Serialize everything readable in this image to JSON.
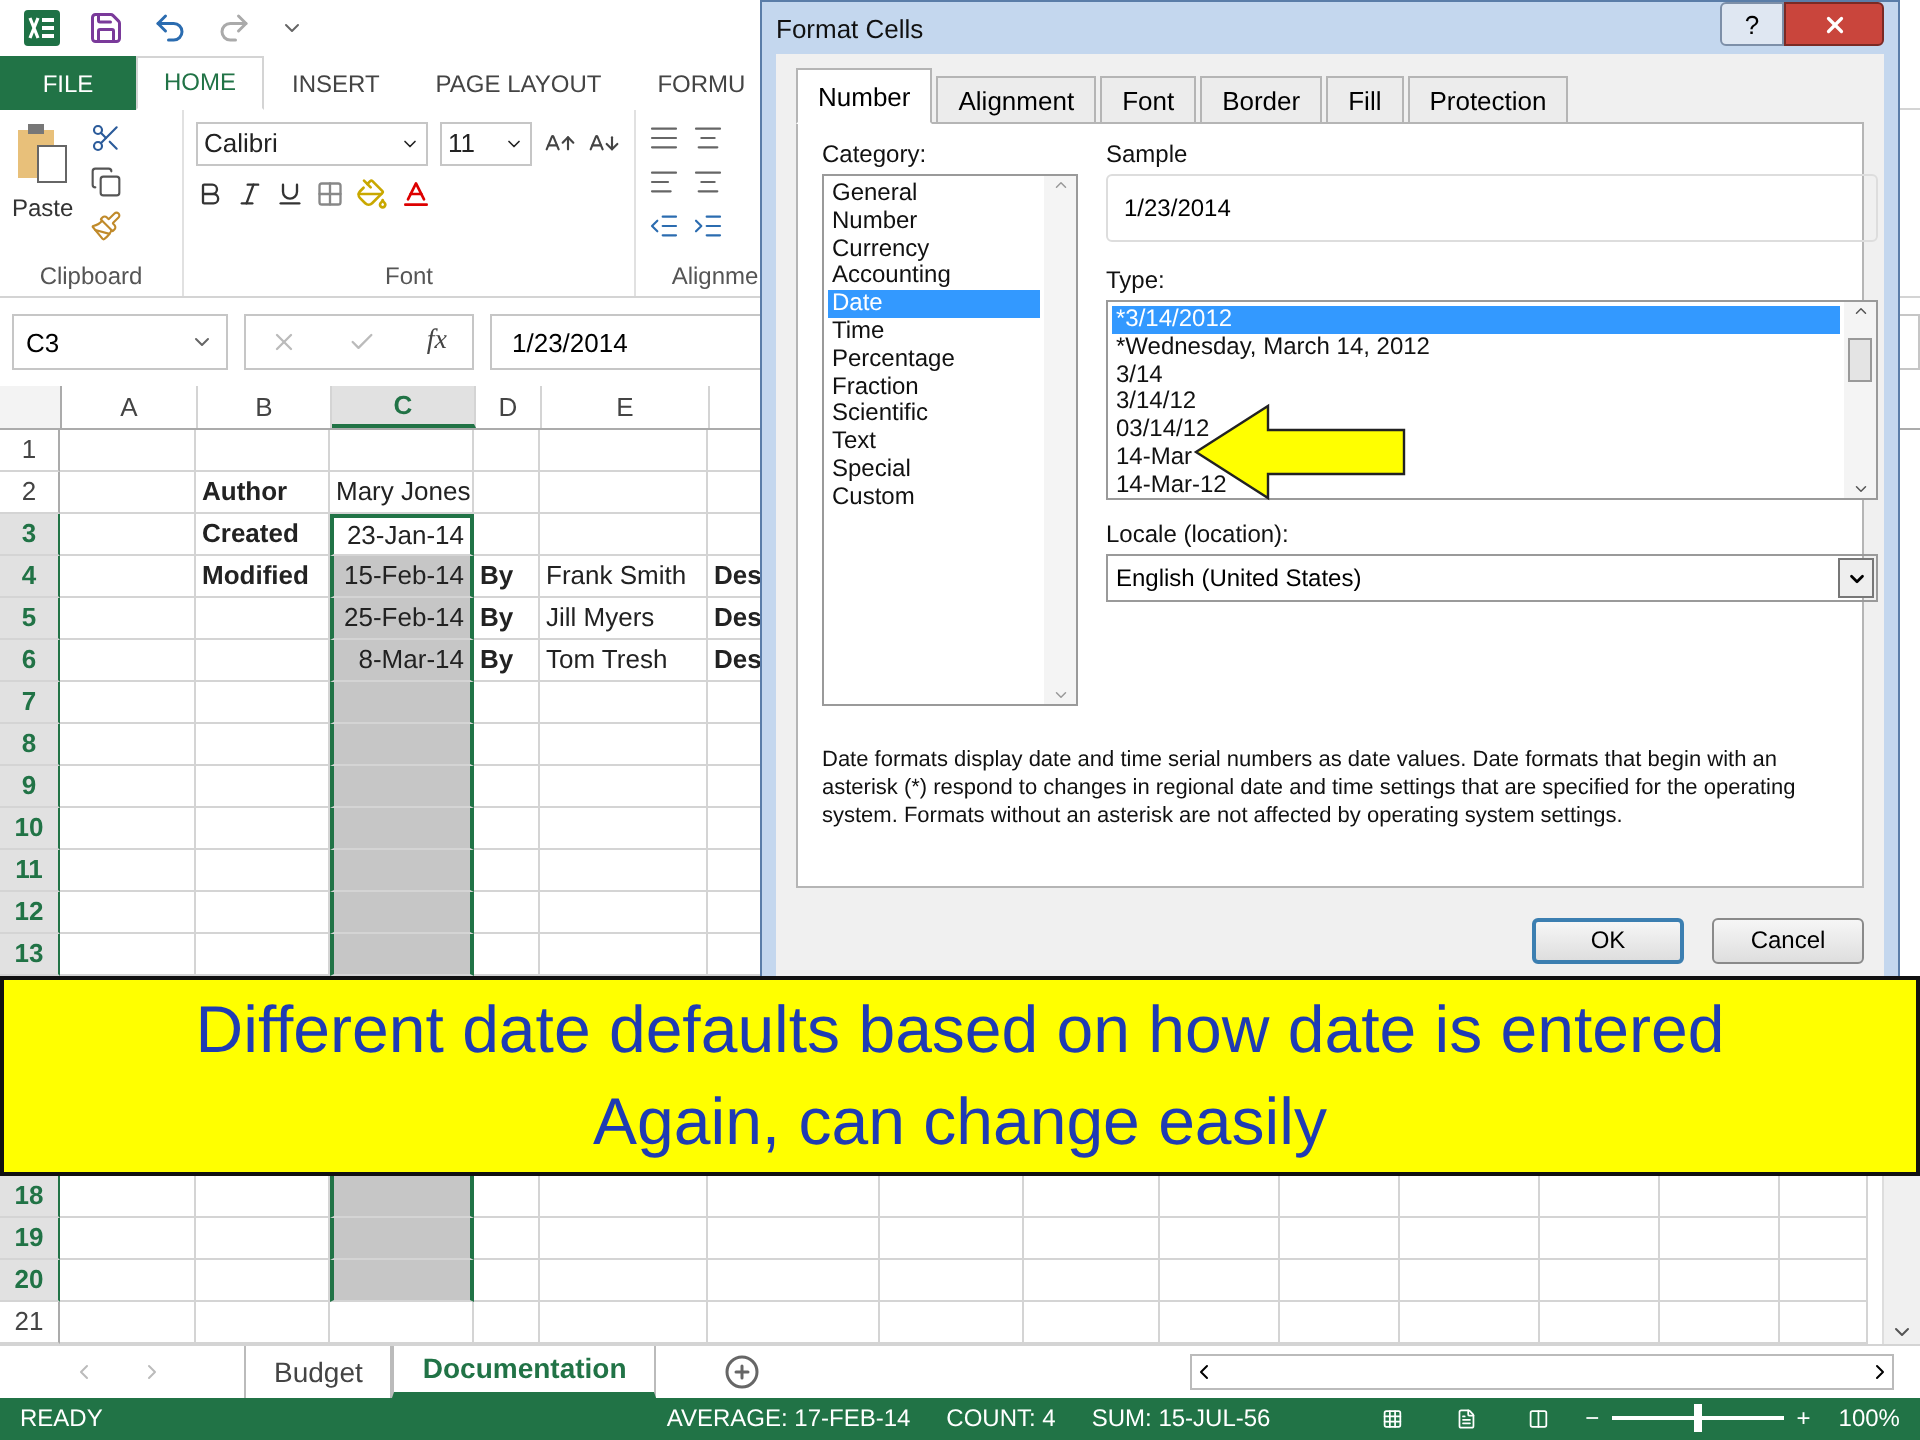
{
  "ribbon_tabs": [
    {
      "label": "FILE",
      "kind": "file",
      "selected": false
    },
    {
      "label": "HOME",
      "kind": "tab",
      "selected": true
    },
    {
      "label": "INSERT",
      "kind": "tab",
      "selected": false
    },
    {
      "label": "PAGE LAYOUT",
      "kind": "tab",
      "selected": false
    },
    {
      "label": "FORMU",
      "kind": "tab",
      "selected": false
    }
  ],
  "ribbon": {
    "paste_label": "Paste",
    "font_name": "Calibri",
    "font_size": "11",
    "groups": [
      "Clipboard",
      "Font",
      "Alignme"
    ]
  },
  "formula_bar": {
    "name_box": "C3",
    "fx": "fx",
    "value": "1/23/2014"
  },
  "sheet": {
    "columns": [
      {
        "label": "A",
        "selected": false
      },
      {
        "label": "B",
        "selected": false
      },
      {
        "label": "C",
        "selected": true
      },
      {
        "label": "D",
        "selected": false
      },
      {
        "label": "E",
        "selected": false
      }
    ],
    "rows_top": [
      {
        "number": "1",
        "selected": false,
        "active": false
      },
      {
        "number": "2",
        "selected": false,
        "active": false,
        "cells": {
          "B": {
            "text": "Author",
            "kind": "label"
          },
          "C": {
            "text": "Mary Jones",
            "kind": "text"
          }
        }
      },
      {
        "number": "3",
        "selected": true,
        "active": true,
        "cells": {
          "B": {
            "text": "Created",
            "kind": "label"
          },
          "C": {
            "text": "23-Jan-14",
            "kind": "date"
          }
        }
      },
      {
        "number": "4",
        "selected": true,
        "active": false,
        "cells": {
          "B": {
            "text": "Modified",
            "kind": "label"
          },
          "C": {
            "text": "15-Feb-14",
            "kind": "date"
          },
          "D": {
            "text": "By",
            "kind": "label"
          },
          "E": {
            "text": "Frank Smith",
            "kind": "text"
          },
          "F": {
            "text": "Des",
            "kind": "label"
          }
        }
      },
      {
        "number": "5",
        "selected": true,
        "active": false,
        "cells": {
          "C": {
            "text": "25-Feb-14",
            "kind": "date"
          },
          "D": {
            "text": "By",
            "kind": "label"
          },
          "E": {
            "text": "Jill Myers",
            "kind": "text"
          },
          "F": {
            "text": "Des",
            "kind": "label"
          }
        }
      },
      {
        "number": "6",
        "selected": true,
        "active": false,
        "cells": {
          "C": {
            "text": "8-Mar-14",
            "kind": "date"
          },
          "D": {
            "text": "By",
            "kind": "label"
          },
          "E": {
            "text": "Tom Tresh",
            "kind": "text"
          },
          "F": {
            "text": "Des",
            "kind": "label"
          }
        }
      },
      {
        "number": "7",
        "selected": true,
        "active": false
      },
      {
        "number": "8",
        "selected": true,
        "active": false
      },
      {
        "number": "9",
        "selected": true,
        "active": false
      },
      {
        "number": "10",
        "selected": true,
        "active": false
      },
      {
        "number": "11",
        "selected": true,
        "active": false
      },
      {
        "number": "12",
        "selected": true,
        "active": false
      },
      {
        "number": "13",
        "selected": true,
        "active": false
      }
    ],
    "rows_bottom": [
      {
        "number": "18",
        "selected": true,
        "active": false
      },
      {
        "number": "19",
        "selected": true,
        "active": false
      },
      {
        "number": "20",
        "selected": true,
        "active": false
      },
      {
        "number": "21",
        "selected": false,
        "active": false
      }
    ],
    "sheet_tabs": [
      {
        "label": "Budget",
        "selected": false
      },
      {
        "label": "Documentation",
        "selected": true
      }
    ]
  },
  "banner": {
    "lines": [
      "Different date defaults based on how date is entered",
      "Again, can change easily"
    ]
  },
  "dialog": {
    "title": "Format Cells",
    "help": "?",
    "tabs": [
      {
        "label": "Number",
        "selected": true
      },
      {
        "label": "Alignment",
        "selected": false
      },
      {
        "label": "Font",
        "selected": false
      },
      {
        "label": "Border",
        "selected": false
      },
      {
        "label": "Fill",
        "selected": false
      },
      {
        "label": "Protection",
        "selected": false
      }
    ],
    "category_label": "Category:",
    "categories": [
      {
        "label": "General",
        "selected": false
      },
      {
        "label": "Number",
        "selected": false
      },
      {
        "label": "Currency",
        "selected": false
      },
      {
        "label": "Accounting",
        "selected": false
      },
      {
        "label": "Date",
        "selected": true
      },
      {
        "label": "Time",
        "selected": false
      },
      {
        "label": "Percentage",
        "selected": false
      },
      {
        "label": "Fraction",
        "selected": false
      },
      {
        "label": "Scientific",
        "selected": false
      },
      {
        "label": "Text",
        "selected": false
      },
      {
        "label": "Special",
        "selected": false
      },
      {
        "label": "Custom",
        "selected": false
      }
    ],
    "sample_label": "Sample",
    "sample_value": "1/23/2014",
    "type_label": "Type:",
    "types": [
      {
        "label": "*3/14/2012",
        "selected": true
      },
      {
        "label": "*Wednesday, March 14, 2012",
        "selected": false
      },
      {
        "label": "3/14",
        "selected": false
      },
      {
        "label": "3/14/12",
        "selected": false
      },
      {
        "label": "03/14/12",
        "selected": false
      },
      {
        "label": "14-Mar",
        "selected": false
      },
      {
        "label": "14-Mar-12",
        "selected": false
      }
    ],
    "locale_label": "Locale (location):",
    "locale_value": "English (United States)",
    "description": "Date formats display date and time serial numbers as date values.  Date formats that begin with an asterisk (*) respond to changes in regional date and time settings that are specified for the operating system. Formats without an asterisk are not affected by operating system settings.",
    "buttons": [
      {
        "label": "OK",
        "kind": "default"
      },
      {
        "label": "Cancel",
        "kind": "normal"
      }
    ]
  },
  "status_bar": {
    "mode": "READY",
    "stats": [
      "AVERAGE: 17-FEB-14",
      "COUNT: 4",
      "SUM: 15-JUL-56"
    ],
    "zoom_minus": "−",
    "zoom_plus": "+",
    "zoom_slider": {
      "level": 0.5
    },
    "zoom": "100%"
  }
}
